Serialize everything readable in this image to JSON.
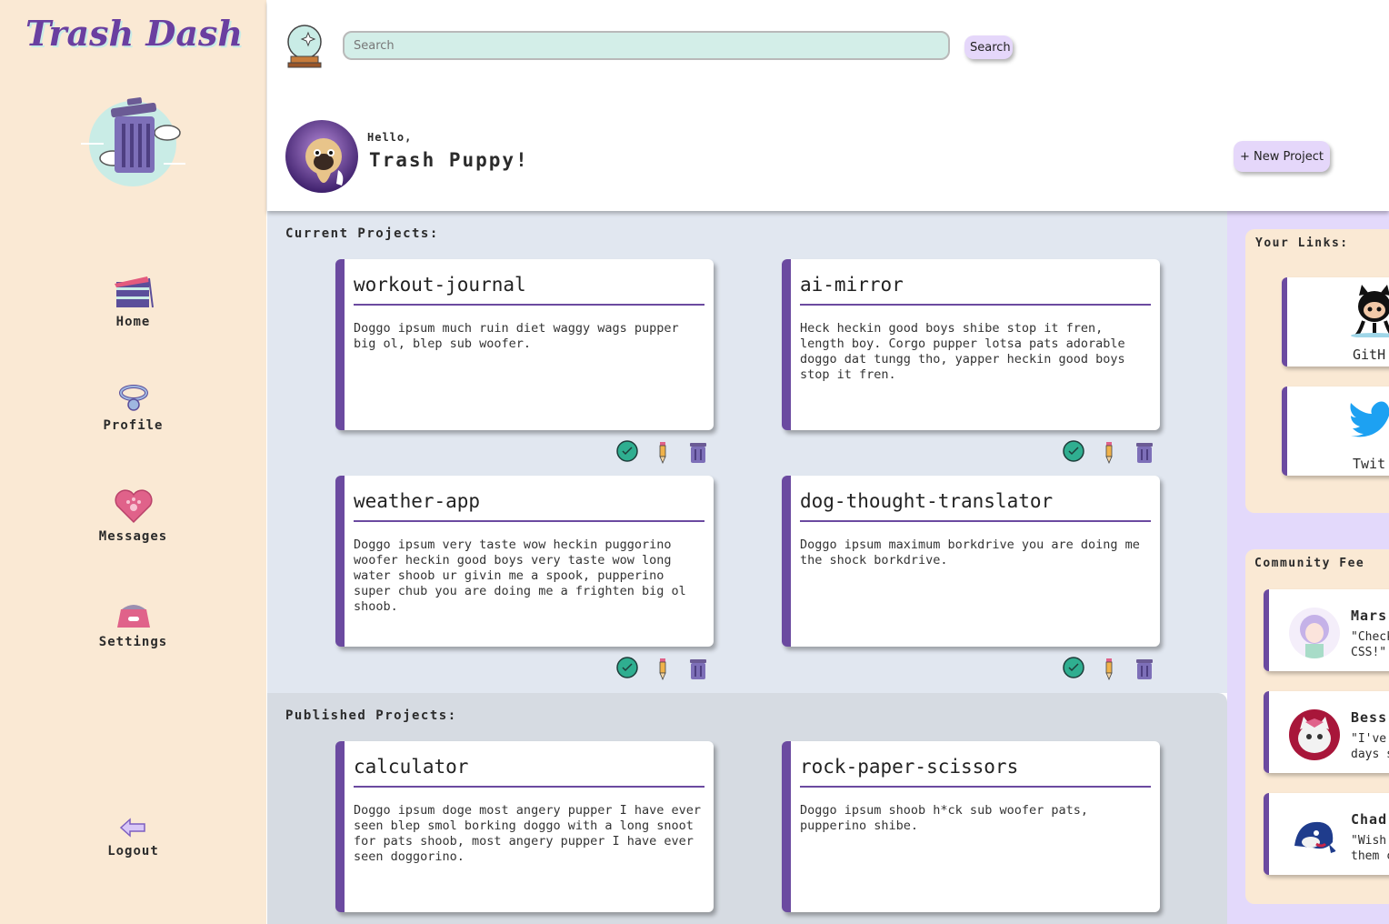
{
  "brand": {
    "title": "Trash Dash"
  },
  "nav": {
    "home": "Home",
    "profile": "Profile",
    "messages": "Messages",
    "settings": "Settings",
    "logout": "Logout"
  },
  "search": {
    "placeholder": "Search",
    "value": "",
    "button": "Search"
  },
  "greeting": {
    "hello": "Hello,",
    "name": "Trash Puppy!"
  },
  "header": {
    "new_project": "+ New Project"
  },
  "current": {
    "title": "Current Projects:",
    "projects": [
      {
        "name": "workout-journal",
        "desc": "Doggo ipsum much ruin diet waggy wags pupper big ol, blep sub woofer."
      },
      {
        "name": "ai-mirror",
        "desc": "Heck heckin good boys shibe stop it fren, length boy. Corgo pupper lotsa pats adorable doggo dat tungg tho, yapper heckin good boys stop it fren."
      },
      {
        "name": "weather-app",
        "desc": "Doggo ipsum very taste wow heckin puggorino woofer heckin good boys very taste wow long water shoob ur givin me a spook, pupperino super chub you are doing me a frighten big ol shoob."
      },
      {
        "name": "dog-thought-translator",
        "desc": "Doggo ipsum maximum borkdrive you are doing me the shock borkdrive."
      }
    ]
  },
  "published": {
    "title": "Published Projects:",
    "projects": [
      {
        "name": "calculator",
        "desc": "Doggo ipsum doge most angery pupper I have ever seen blep smol borking doggo with a long snoot for pats shoob, most angery pupper I have ever seen doggorino."
      },
      {
        "name": "rock-paper-scissors",
        "desc": "Doggo ipsum shoob h*ck sub woofer pats, pupperino shibe."
      }
    ]
  },
  "links": {
    "title": "Your Links:",
    "items": [
      {
        "label": "GitH",
        "icon": "github-icon"
      },
      {
        "label": "Twit",
        "icon": "twitter-icon"
      }
    ]
  },
  "feed": {
    "title": "Community Fee",
    "items": [
      {
        "name": "Mars",
        "quote": "\"Check\nCSS!\""
      },
      {
        "name": "Bess",
        "quote": "\"I've\ndays s"
      },
      {
        "name": "Chad",
        "quote": "\"Wish\nthem c"
      }
    ]
  },
  "colors": {
    "sidebar": "#fae9d4",
    "accent": "#6b4aa0",
    "current_bg": "#e1e7f0",
    "published_bg": "#d6dbe2",
    "right_bg": "#e3d9fb",
    "search_bg": "#d3eee8",
    "button_bg": "#e5d7fa"
  }
}
